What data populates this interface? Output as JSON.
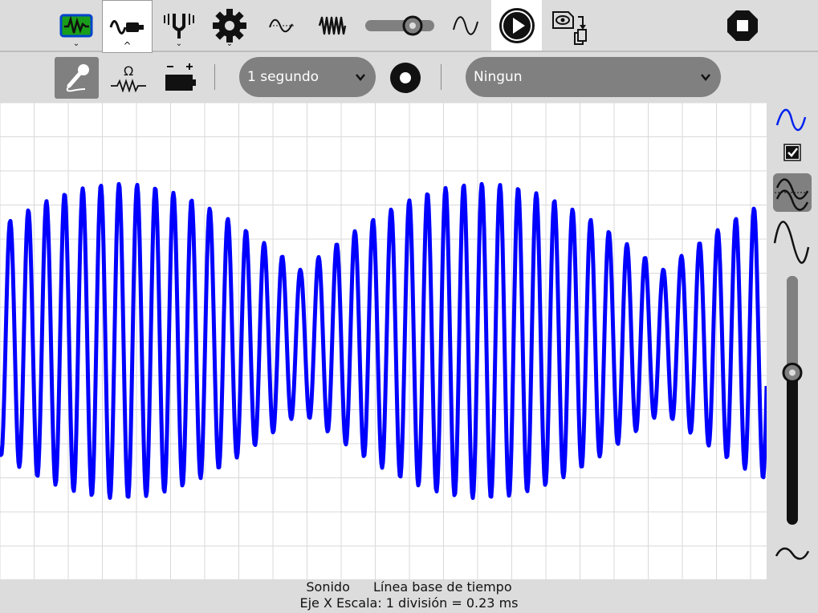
{
  "toolbar": {
    "items": [
      {
        "name": "oscilloscope-tab",
        "icon": "oscilloscope-icon",
        "has_arrow": true,
        "arrow": "⌄"
      },
      {
        "name": "sensor-tab",
        "icon": "sensor-probe-icon",
        "has_arrow": true,
        "arrow": "^",
        "active": true
      },
      {
        "name": "tuning-fork-tab",
        "icon": "tuning-fork-icon",
        "has_arrow": true,
        "arrow": "⌄"
      },
      {
        "name": "settings-tab",
        "icon": "gear-icon",
        "has_arrow": true,
        "arrow": "⌄"
      },
      {
        "name": "low-frequency-button",
        "icon": "slow-wave-icon"
      },
      {
        "name": "high-frequency-button",
        "icon": "fast-wave-icon"
      },
      {
        "name": "sine-wave-button",
        "icon": "sine-wave-icon"
      },
      {
        "name": "play-button",
        "icon": "play-icon"
      },
      {
        "name": "capture-button",
        "icon": "capture-screen-icon"
      },
      {
        "name": "stop-button",
        "icon": "stop-icon"
      }
    ],
    "slider_value": 0.75
  },
  "subbar": {
    "record_interval": "1 segundo",
    "trigger": "Ningun"
  },
  "plot": {
    "wave_color": "#0000ff",
    "grid_color": "#d9d9d9"
  },
  "sidebar": {
    "gain_slider_value": 0.62,
    "checkbox_checked": true
  },
  "status": {
    "source": "Sonido",
    "mode": "Línea base de tiempo",
    "scale": "Eje X Escala: 1 división = 0.23 ms"
  }
}
